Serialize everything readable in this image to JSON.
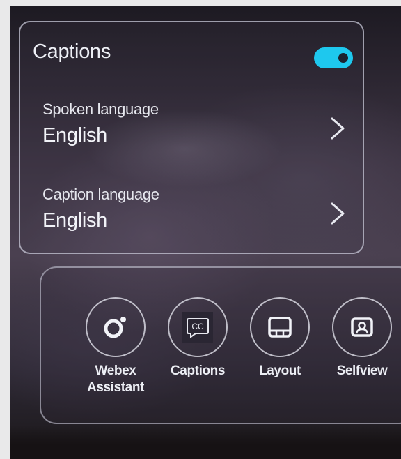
{
  "captions_panel": {
    "title": "Captions",
    "toggle_on": true,
    "accent_color": "#1ec8ee",
    "rows": [
      {
        "label": "Spoken language",
        "value": "English",
        "icon": "chevron-right-icon"
      },
      {
        "label": "Caption language",
        "value": "English",
        "icon": "chevron-right-icon"
      }
    ]
  },
  "toolbar": {
    "buttons": [
      {
        "label": "Webex\nAssistant",
        "icon": "webex-assistant-icon"
      },
      {
        "label": "Captions",
        "icon": "closed-captions-icon",
        "icon_text": "CC"
      },
      {
        "label": "Layout",
        "icon": "layout-icon"
      },
      {
        "label": "Selfview",
        "icon": "selfview-icon"
      }
    ]
  }
}
